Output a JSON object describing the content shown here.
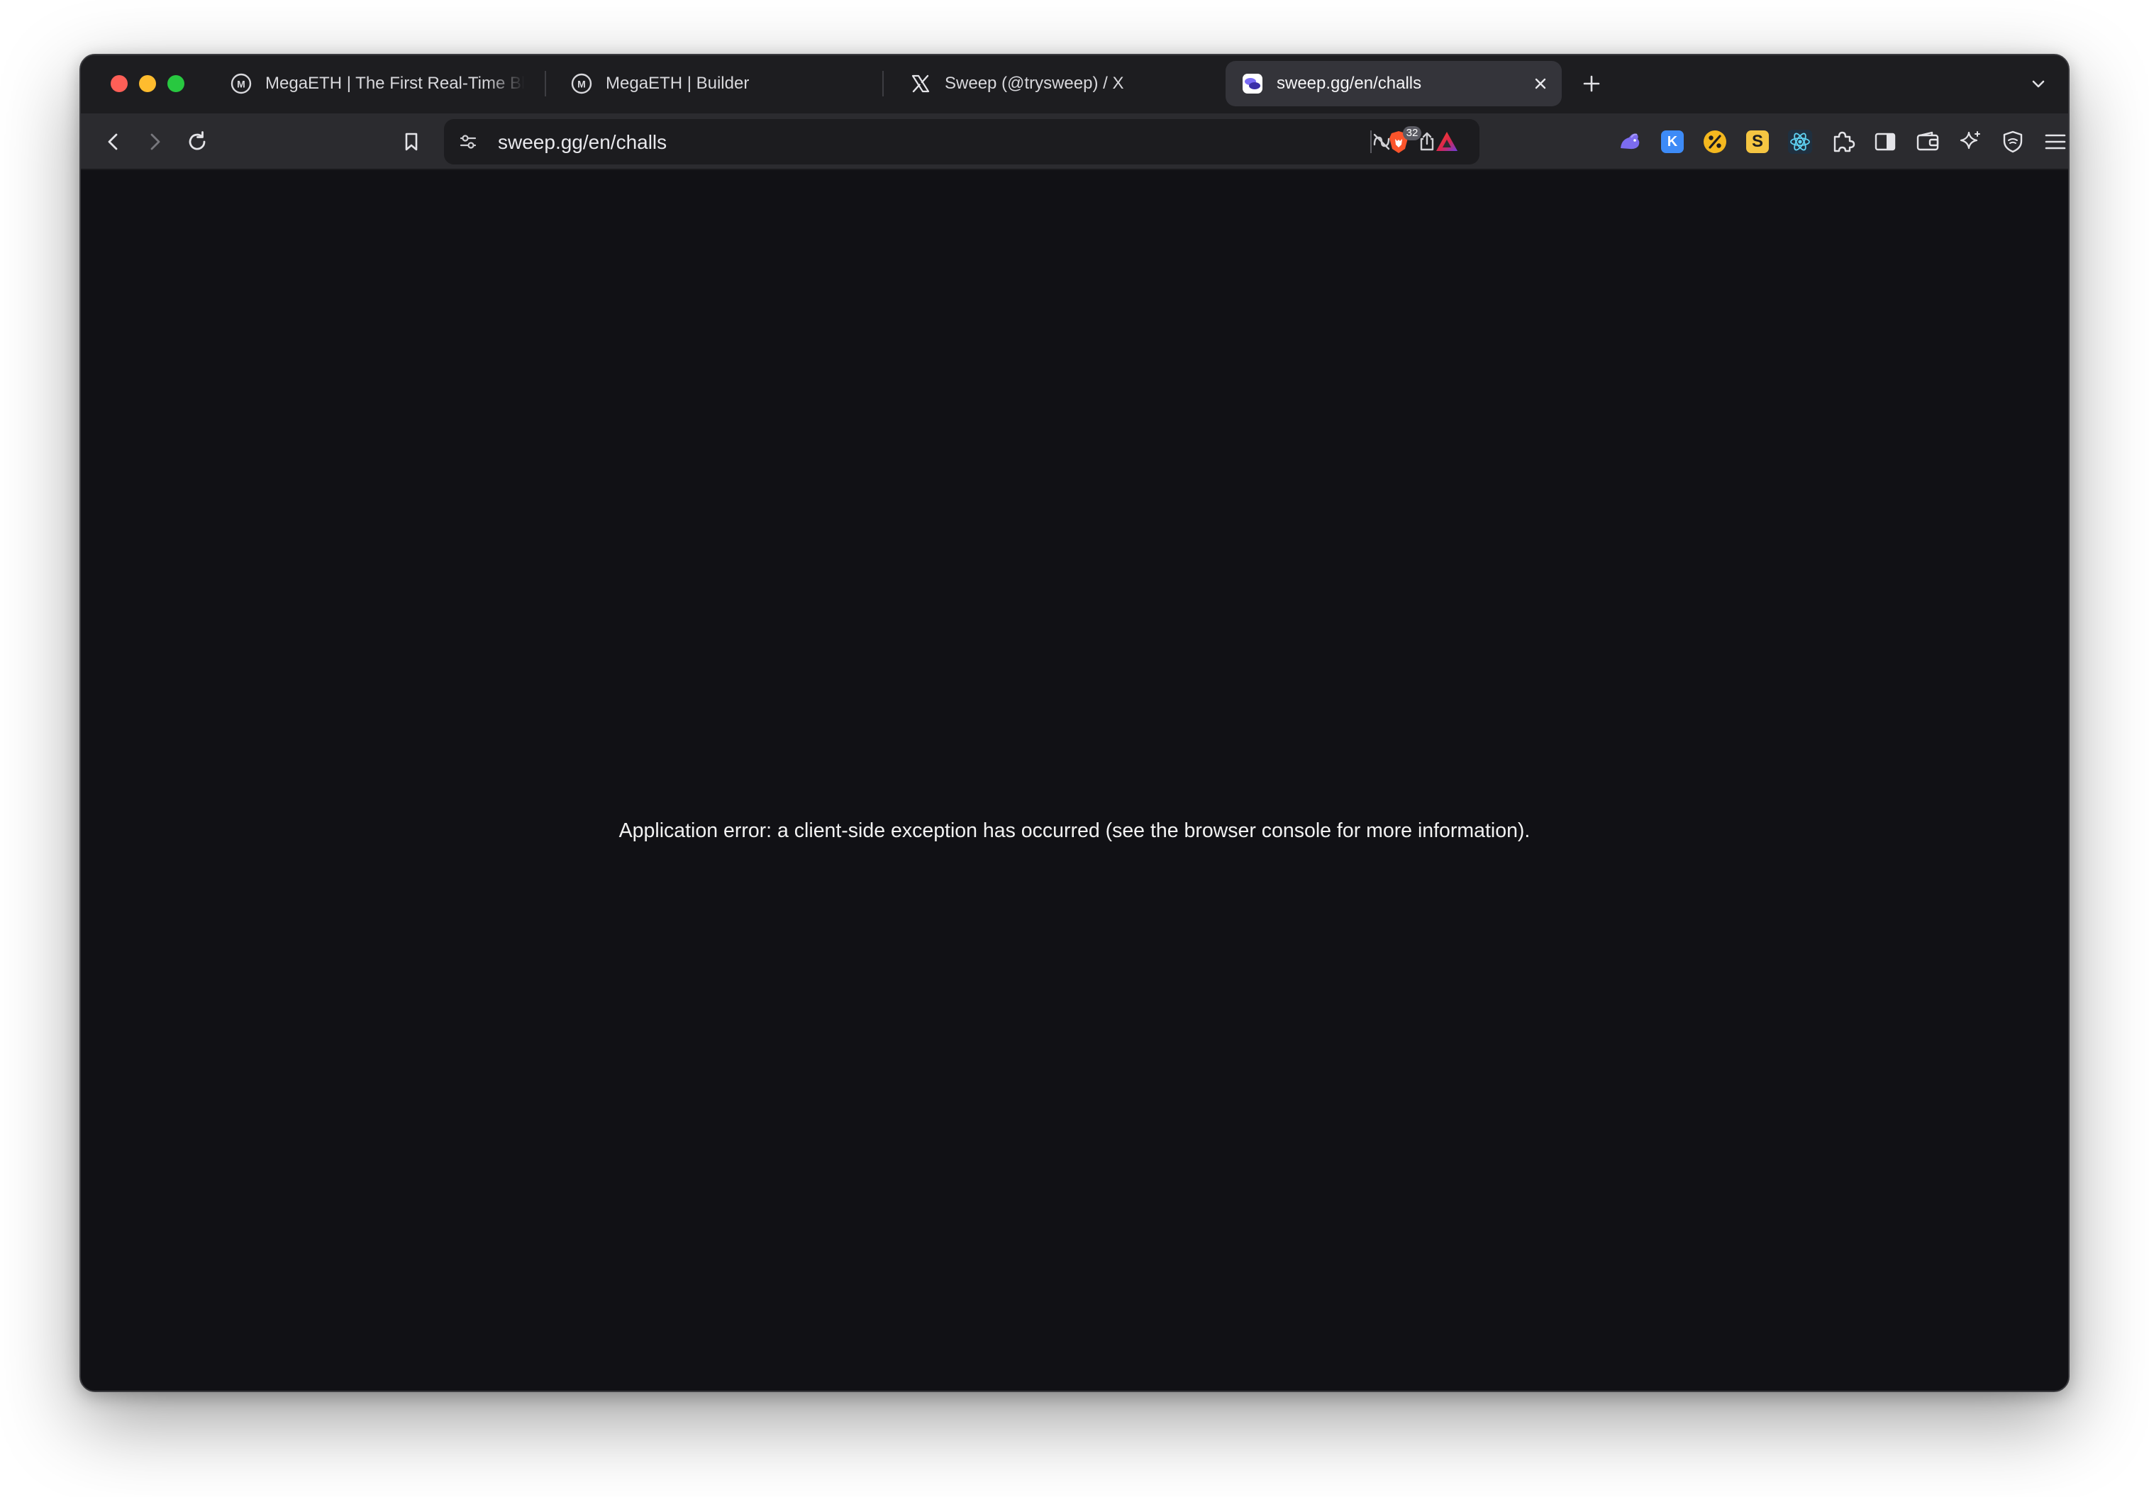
{
  "tabs": [
    {
      "label": "MegaETH | The First Real-Time Bl",
      "favicon": "megaeth-logo-icon",
      "active": false
    },
    {
      "label": "MegaETH | Builder",
      "favicon": "megaeth-logo-icon",
      "active": false
    },
    {
      "label": "Sweep (@trysweep) / X",
      "favicon": "x-logo-icon",
      "active": false
    },
    {
      "label": "sweep.gg/en/challs",
      "favicon": "sweep-logo-icon",
      "active": true
    }
  ],
  "address_bar": {
    "url": "sweep.gg/en/challs"
  },
  "shields": {
    "count": "32"
  },
  "extensions": [
    {
      "name": "rabbit-extension-icon",
      "color": "#7c6cf0"
    },
    {
      "name": "k-extension-icon",
      "letter": "K",
      "color": "#3d8bf7"
    },
    {
      "name": "percent-extension-icon",
      "letter": "%",
      "color": "#f4b81f"
    },
    {
      "name": "s-extension-icon",
      "letter": "S",
      "color": "#f5c542"
    },
    {
      "name": "react-devtools-icon",
      "color": "#5fd3f3"
    }
  ],
  "page": {
    "error_message": "Application error: a client-side exception has occurred (see the browser console for more information)."
  },
  "colors": {
    "page_background": "#111115",
    "tabstrip_background": "#1d1d20",
    "toolbar_background": "#2b2b2f",
    "brave_orange": "#fb542b"
  }
}
